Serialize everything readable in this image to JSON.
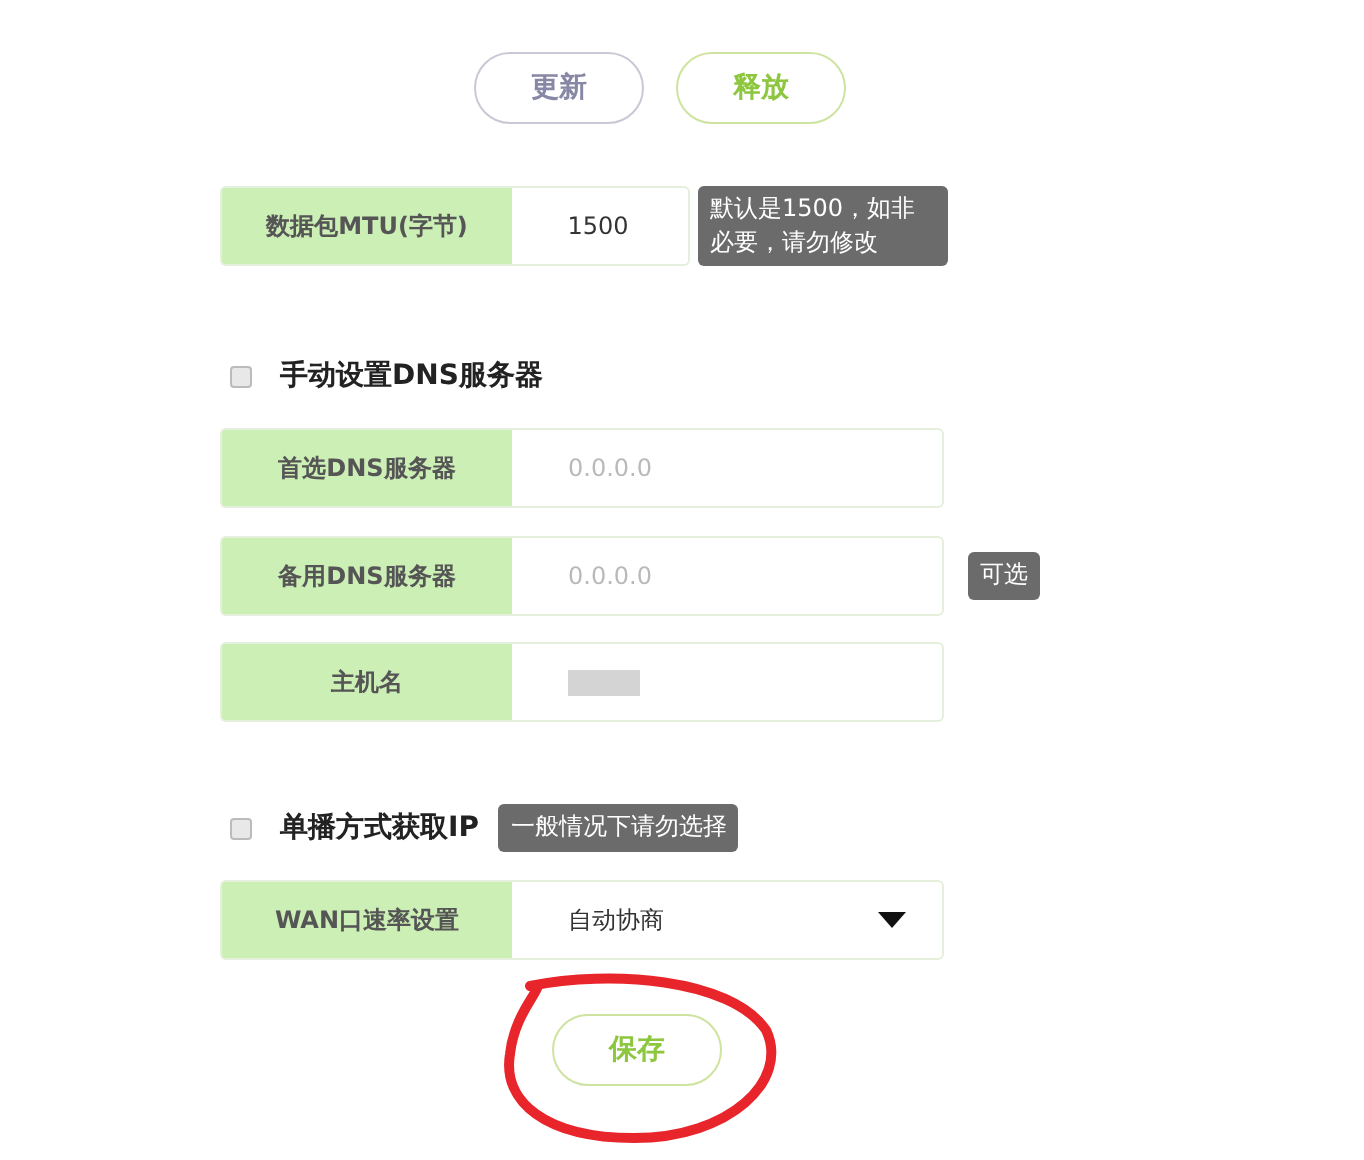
{
  "buttons": [
    {
      "label": "更新",
      "kind": "default"
    },
    {
      "label": "释放",
      "kind": "primary"
    }
  ],
  "rows": [
    {
      "kind": "field",
      "label": "数据包MTU(字节)",
      "value": "1500",
      "narrow": true,
      "hint": "默认是1500，如非必要，请勿修改"
    },
    {
      "kind": "checkbox",
      "label": "手动设置DNS服务器",
      "checked": false
    },
    {
      "kind": "field",
      "label": "首选DNS服务器",
      "placeholder": "0.0.0.0"
    },
    {
      "kind": "field",
      "label": "备用DNS服务器",
      "placeholder": "0.0.0.0",
      "hint": "可选"
    },
    {
      "kind": "field",
      "label": "主机名",
      "redacted": true
    },
    {
      "kind": "checkbox",
      "label": "单播方式获取IP",
      "checked": false,
      "hint": "一般情况下请勿选择"
    },
    {
      "kind": "select",
      "label": "WAN口速率设置",
      "value": "自动协商"
    }
  ],
  "save_button": {
    "label": "保存"
  },
  "annotation": {
    "kind": "circle"
  }
}
